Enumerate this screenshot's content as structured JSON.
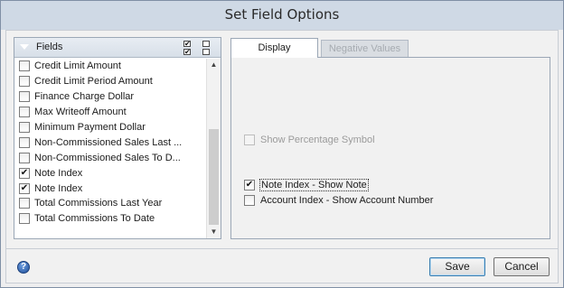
{
  "window": {
    "title": "Set Field Options"
  },
  "fields_panel": {
    "title": "Fields",
    "header_icons": [
      "collapse-triangle-icon",
      "check-all-icon",
      "uncheck-all-icon"
    ],
    "items": [
      {
        "label": "Credit Limit Amount",
        "checked": false
      },
      {
        "label": "Credit Limit Period Amount",
        "checked": false
      },
      {
        "label": "Finance Charge Dollar",
        "checked": false
      },
      {
        "label": "Max Writeoff Amount",
        "checked": false
      },
      {
        "label": "Minimum Payment Dollar",
        "checked": false
      },
      {
        "label": "Non-Commissioned Sales Last ...",
        "checked": false
      },
      {
        "label": "Non-Commissioned Sales To D...",
        "checked": false
      },
      {
        "label": "Note Index",
        "checked": true
      },
      {
        "label": "Note Index",
        "checked": true
      },
      {
        "label": "Total Commissions Last Year",
        "checked": false
      },
      {
        "label": "Total Commissions To Date",
        "checked": false
      }
    ],
    "scrollbar": {
      "up_glyph": "▲",
      "down_glyph": "▼"
    }
  },
  "tabs": [
    {
      "label": "Display",
      "active": true
    },
    {
      "label": "Negative Values",
      "active": false
    }
  ],
  "display_options": {
    "show_percentage_symbol": {
      "label": "Show Percentage Symbol",
      "checked": false,
      "enabled": false
    },
    "note_index_show_note": {
      "label": "Note Index - Show Note",
      "checked": true,
      "enabled": true
    },
    "account_index_show_account_number": {
      "label": "Account Index - Show Account Number",
      "checked": false,
      "enabled": true
    }
  },
  "footer": {
    "help_icon": "help-icon",
    "help_glyph": "?",
    "save_label": "Save",
    "cancel_label": "Cancel"
  },
  "check_glyph": "✔"
}
